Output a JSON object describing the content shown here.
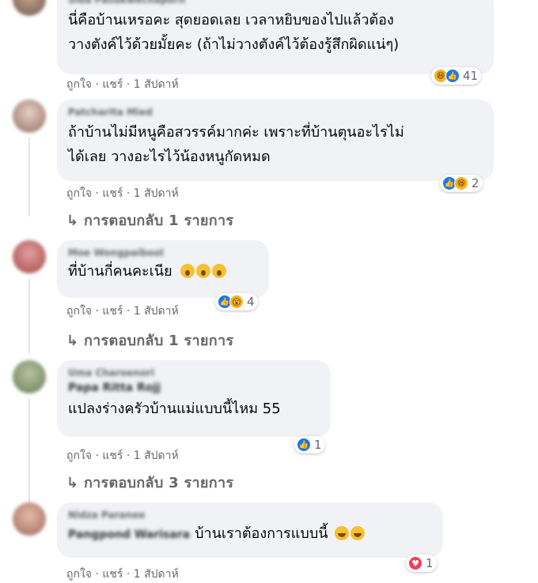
{
  "comments": [
    {
      "author": "Sida Pasukwechaporn",
      "text": "นี่คือบ้านเหรอคะ สุดยอดเลย เวลาหยิบของไปแล้วต้อง\nวางตังค์ไว้ด้วยมั้ยคะ (ถ้าไม่วางตังค์ไว้ต้องรู้สึกผิดแน่ๆ)",
      "like_label": "ถูกใจ",
      "share_label": "แชร์",
      "time": "1 สัปดาห์",
      "reaction_count": "41",
      "reaction_icons": [
        "haha-icon",
        "like-icon"
      ]
    },
    {
      "author": "Patcharita Mied",
      "text": "ถ้าบ้านไม่มีหนูคือสวรรค์มากค่ะ เพราะที่บ้านตุนอะไรไม่\nได้เลย วางอะไรไว้น้องหนูกัดหมด",
      "like_label": "ถูกใจ",
      "share_label": "แชร์",
      "time": "1 สัปดาห์",
      "reaction_count": "2",
      "reaction_icons": [
        "like-icon",
        "haha-icon"
      ],
      "replies": "↳ การตอบกลับ 1 รายการ"
    },
    {
      "author": "Moe Wongpaibool",
      "text": "ที่บ้านกี่คนคะเนีย",
      "like_label": "ถูกใจ",
      "share_label": "แชร์",
      "time": "1 สัปดาห์",
      "reaction_count": "4",
      "reaction_icons": [
        "like-icon",
        "wow-icon"
      ],
      "replies": "↳ การตอบกลับ 1 รายการ"
    },
    {
      "author": "Uma Charoenori",
      "tag": "Papa Ritta Rojj",
      "text": "แปลงร่างครัวบ้านแม่แบบนี้ไหม 55",
      "like_label": "ถูกใจ",
      "share_label": "แชร์",
      "time": "1 สัปดาห์",
      "reaction_count": "1",
      "reaction_icons": [
        "like-icon"
      ],
      "replies": "↳ การตอบกลับ 3 รายการ"
    },
    {
      "author": "Nidza Paranee",
      "tag": "Pangpond Warisara",
      "text": "บ้านเราต้องการแบบนี้",
      "like_label": "ถูกใจ",
      "share_label": "แชร์",
      "time": "1 สัปดาห์",
      "reaction_count": "1",
      "reaction_icons": [
        "love-icon"
      ]
    }
  ],
  "separator": "·",
  "colors": {
    "bubble": "#f0f2f5",
    "meta": "#65676b",
    "like": "#1877f2",
    "haha": "#f7b125",
    "love": "#f33e58"
  }
}
